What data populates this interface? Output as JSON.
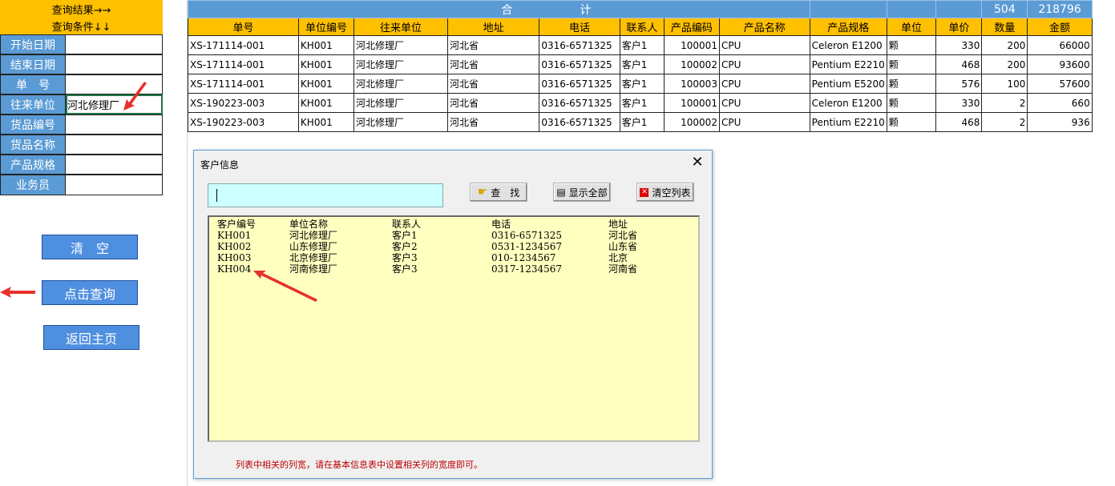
{
  "left_panel": {
    "query_result_label": "查询结果→→",
    "query_condition_label": "查询条件↓↓",
    "fields": [
      {
        "label": "开始日期",
        "value": ""
      },
      {
        "label": "结束日期",
        "value": ""
      },
      {
        "label": "单　号",
        "value": ""
      },
      {
        "label": "往来单位",
        "value": "河北修理厂"
      },
      {
        "label": "货品编号",
        "value": ""
      },
      {
        "label": "货品名称",
        "value": ""
      },
      {
        "label": "产品规格",
        "value": ""
      },
      {
        "label": "业务员",
        "value": ""
      }
    ],
    "buttons": {
      "clear": "清　空",
      "query": "点击查询",
      "home": "返回主页"
    }
  },
  "summary": {
    "total_label": "合　　　　　　计",
    "total_quantity": "504",
    "total_amount": "218796"
  },
  "table": {
    "columns": [
      "单号",
      "单位编号",
      "往来单位",
      "地址",
      "电话",
      "联系人",
      "产品编码",
      "产品名称",
      "产品规格",
      "单位",
      "单价",
      "数量",
      "金额"
    ],
    "rows": [
      [
        "XS-171114-001",
        "KH001",
        "河北修理厂",
        "河北省",
        "0316-6571325",
        "客户1",
        "100001",
        "CPU",
        "Celeron E1200",
        "颗",
        "330",
        "200",
        "66000"
      ],
      [
        "XS-171114-001",
        "KH001",
        "河北修理厂",
        "河北省",
        "0316-6571325",
        "客户1",
        "100002",
        "CPU",
        "Pentium E2210",
        "颗",
        "468",
        "200",
        "93600"
      ],
      [
        "XS-171114-001",
        "KH001",
        "河北修理厂",
        "河北省",
        "0316-6571325",
        "客户1",
        "100003",
        "CPU",
        "Pentium E5200",
        "颗",
        "576",
        "100",
        "57600"
      ],
      [
        "XS-190223-003",
        "KH001",
        "河北修理厂",
        "河北省",
        "0316-6571325",
        "客户1",
        "100001",
        "CPU",
        "Celeron E1200",
        "颗",
        "330",
        "2",
        "660"
      ],
      [
        "XS-190223-003",
        "KH001",
        "河北修理厂",
        "河北省",
        "0316-6571325",
        "客户1",
        "100002",
        "CPU",
        "Pentium E2210",
        "颗",
        "468",
        "2",
        "936"
      ]
    ]
  },
  "dialog": {
    "title": "客户信息",
    "search_value": "",
    "buttons": {
      "find": "查　找",
      "show_all": "显示全部",
      "clear_list": "清空列表"
    },
    "list_headers": [
      "客户编号",
      "单位名称",
      "联系人",
      "电话",
      "地址"
    ],
    "list_rows": [
      [
        "KH001",
        "河北修理厂",
        "客户1",
        "0316-6571325",
        "河北省"
      ],
      [
        "KH002",
        "山东修理厂",
        "客户2",
        "0531-1234567",
        "山东省"
      ],
      [
        "KH003",
        "北京修理厂",
        "客户3",
        "010-1234567",
        "北京"
      ],
      [
        "KH004",
        "河南修理厂",
        "客户3",
        "0317-1234567",
        "河南省"
      ]
    ],
    "note": "列表中相关的列宽，请在基本信息表中设置相关列的宽度即可。"
  },
  "colors": {
    "header_yellow": "#ffc000",
    "label_blue": "#5b9bd5",
    "button_blue": "#4f8fe0",
    "list_bg": "#ffffc0",
    "search_bg": "#ccffff",
    "arrow_red": "#e8302a"
  }
}
